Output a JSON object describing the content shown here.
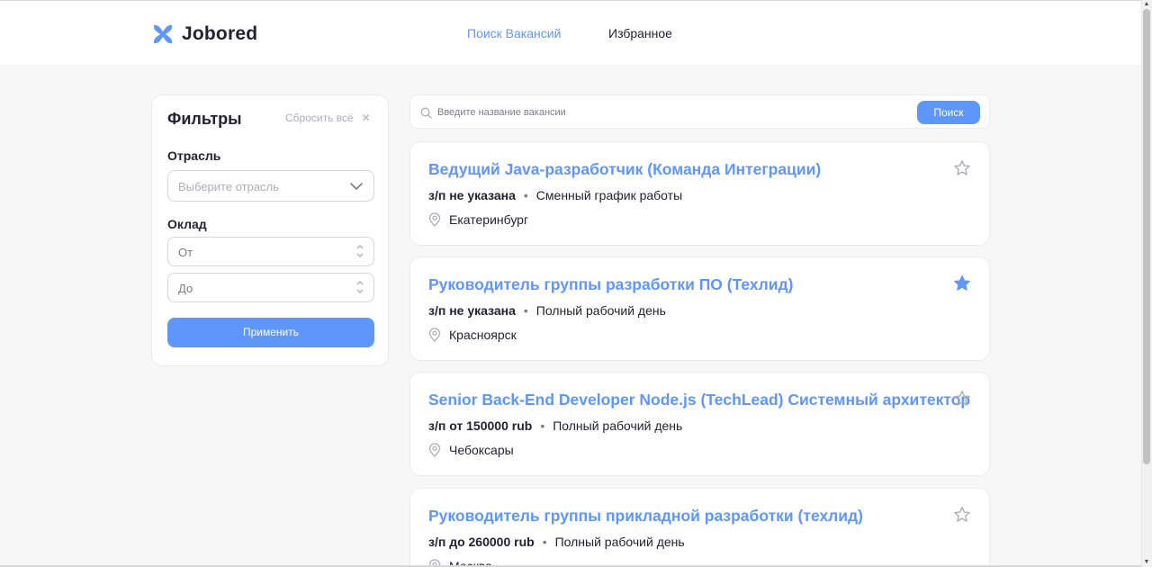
{
  "header": {
    "logo_text": "Jobored",
    "nav": [
      {
        "label": "Поиск Вакансий",
        "active": true
      },
      {
        "label": "Избранное",
        "active": false
      }
    ]
  },
  "filters": {
    "title": "Фильтры",
    "reset_label": "Сбросить всё",
    "industry_label": "Отрасль",
    "industry_placeholder": "Выберите отрасль",
    "salary_label": "Оклад",
    "salary_from_placeholder": "От",
    "salary_to_placeholder": "До",
    "apply_label": "Применить"
  },
  "search": {
    "placeholder": "Введите название вакансии",
    "button_label": "Поиск"
  },
  "vacancies": [
    {
      "title": "Ведущий Java-разработчик (Команда Интеграции)",
      "salary": "з/п не указана",
      "schedule": "Сменный график работы",
      "city": "Екатеринбург",
      "favorite": false
    },
    {
      "title": "Руководитель группы разработки ПО (Техлид)",
      "salary": "з/п не указана",
      "schedule": "Полный рабочий день",
      "city": "Красноярск",
      "favorite": true
    },
    {
      "title": "Senior Back-End Developer Node.js (TechLead) Системный архитектор",
      "salary": "з/п от 150000 rub",
      "schedule": "Полный рабочий день",
      "city": "Чебоксары",
      "favorite": false
    },
    {
      "title": "Руководитель группы прикладной разработки (техлид)",
      "salary": "з/п до 260000 rub",
      "schedule": "Полный рабочий день",
      "city": "Москва",
      "favorite": false
    }
  ],
  "colors": {
    "accent": "#5e96fc",
    "text": "#232134",
    "muted": "#acadb9",
    "background": "#f7f7f8"
  },
  "icons": {
    "logo": "logo-icon",
    "search": "search-icon",
    "chevron": "chevron-down-icon",
    "location": "location-pin-icon",
    "star": "star-icon",
    "close": "close-icon"
  }
}
